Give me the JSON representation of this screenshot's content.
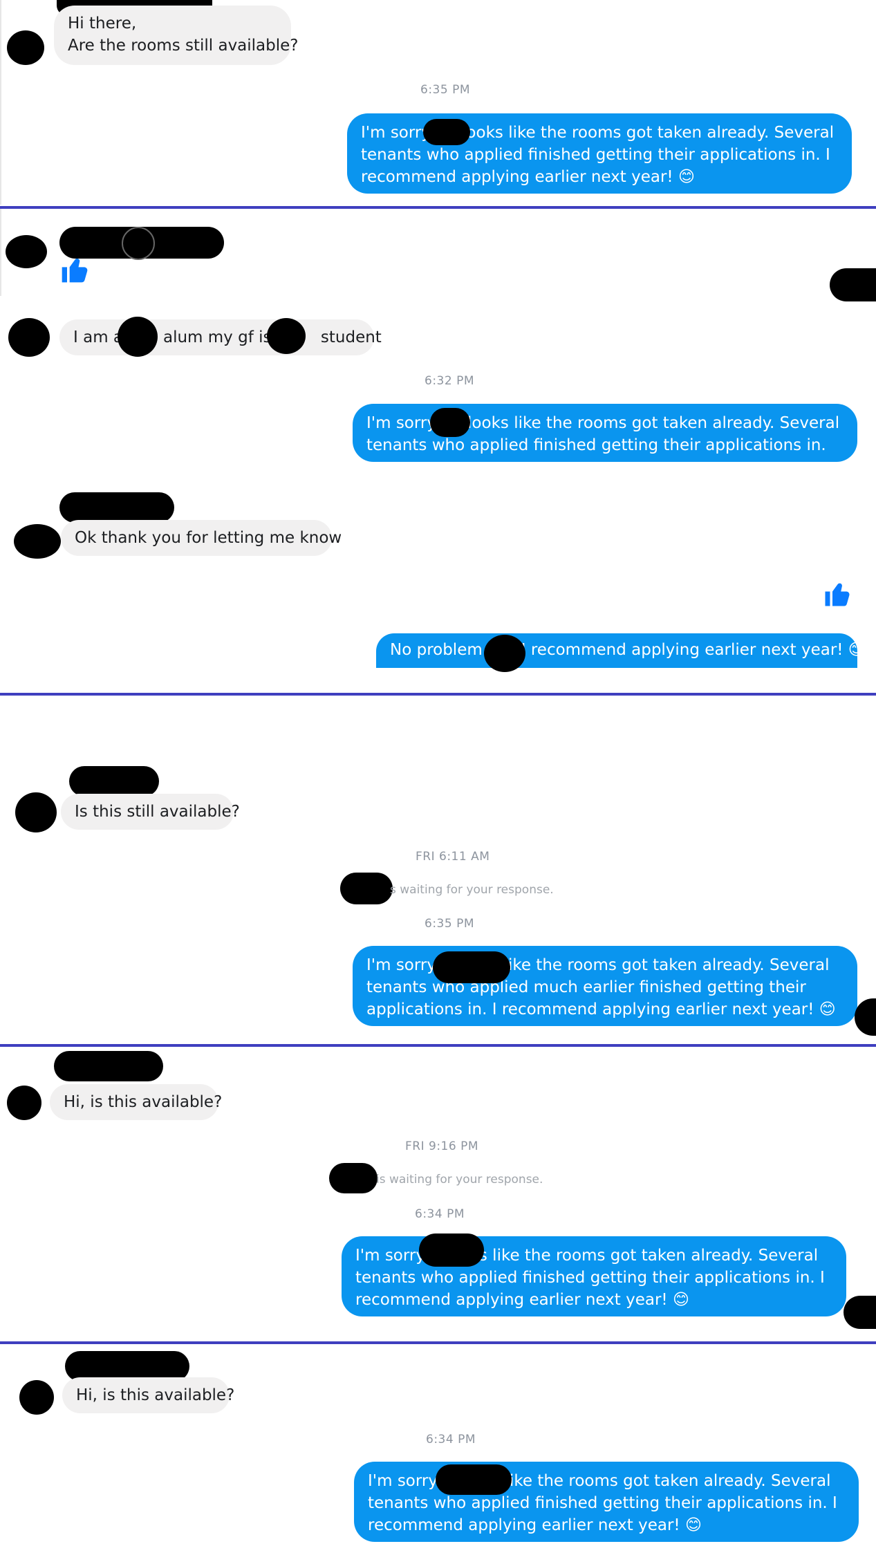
{
  "colors": {
    "outgoing_bubble": "#0a95ef",
    "incoming_bubble": "#f1f0f0",
    "divider": "#3f3fbf",
    "timestamp": "#8d949e",
    "like_icon": "#0a7cff"
  },
  "conversations": [
    {
      "incoming": [
        {
          "text_line1": "Hi there,",
          "text_line2": "Are the rooms still available?"
        }
      ],
      "timestamp": "6:35 PM",
      "outgoing": [
        {
          "text": "I'm sorry . It looks like the rooms got taken already. Several tenants who applied finished getting their applications in. I recommend applying earlier next year! 😊"
        }
      ]
    },
    {
      "incoming": [
        {
          "text": "like-icon"
        },
        {
          "text_pre": "I am a",
          "text_mid1": "alum my gf is a",
          "text_post": "student"
        }
      ],
      "timestamp": "6:32 PM",
      "outgoing": [
        {
          "text": "I'm sorry . It looks like the rooms got taken already. Several tenants who applied finished getting their applications in."
        }
      ],
      "incoming2": {
        "text": "Ok thank you for letting me know"
      },
      "outgoing2": {
        "text_pre": "No problem",
        "text_post": "I recommend applying earlier next year! 😊"
      }
    },
    {
      "incoming": [
        {
          "text": "Is this still available?"
        }
      ],
      "timestamp_day": "FRI 6:11 AM",
      "waiting": "s waiting for your response.",
      "timestamp": "6:35 PM",
      "outgoing": [
        {
          "text": "I'm sorry  It looks like the rooms got taken already. Several tenants who applied much earlier finished getting their applications in. I recommend applying earlier next year! 😊"
        }
      ]
    },
    {
      "incoming": [
        {
          "text": "Hi, is this available?"
        }
      ],
      "timestamp_day": "FRI 9:16 PM",
      "waiting": "is waiting for your response.",
      "timestamp": "6:34 PM",
      "outgoing": [
        {
          "text": "I'm sorry  it looks like the rooms got taken already. Several tenants who applied finished getting their applications in. I recommend applying earlier next year! 😊"
        }
      ]
    },
    {
      "incoming": [
        {
          "text": "Hi, is this available?"
        }
      ],
      "timestamp": "6:34 PM",
      "outgoing": [
        {
          "text": "I'm sorry  It looks like the rooms got taken already. Several tenants who applied finished getting their applications in. I recommend applying earlier next year! 😊"
        }
      ]
    }
  ]
}
